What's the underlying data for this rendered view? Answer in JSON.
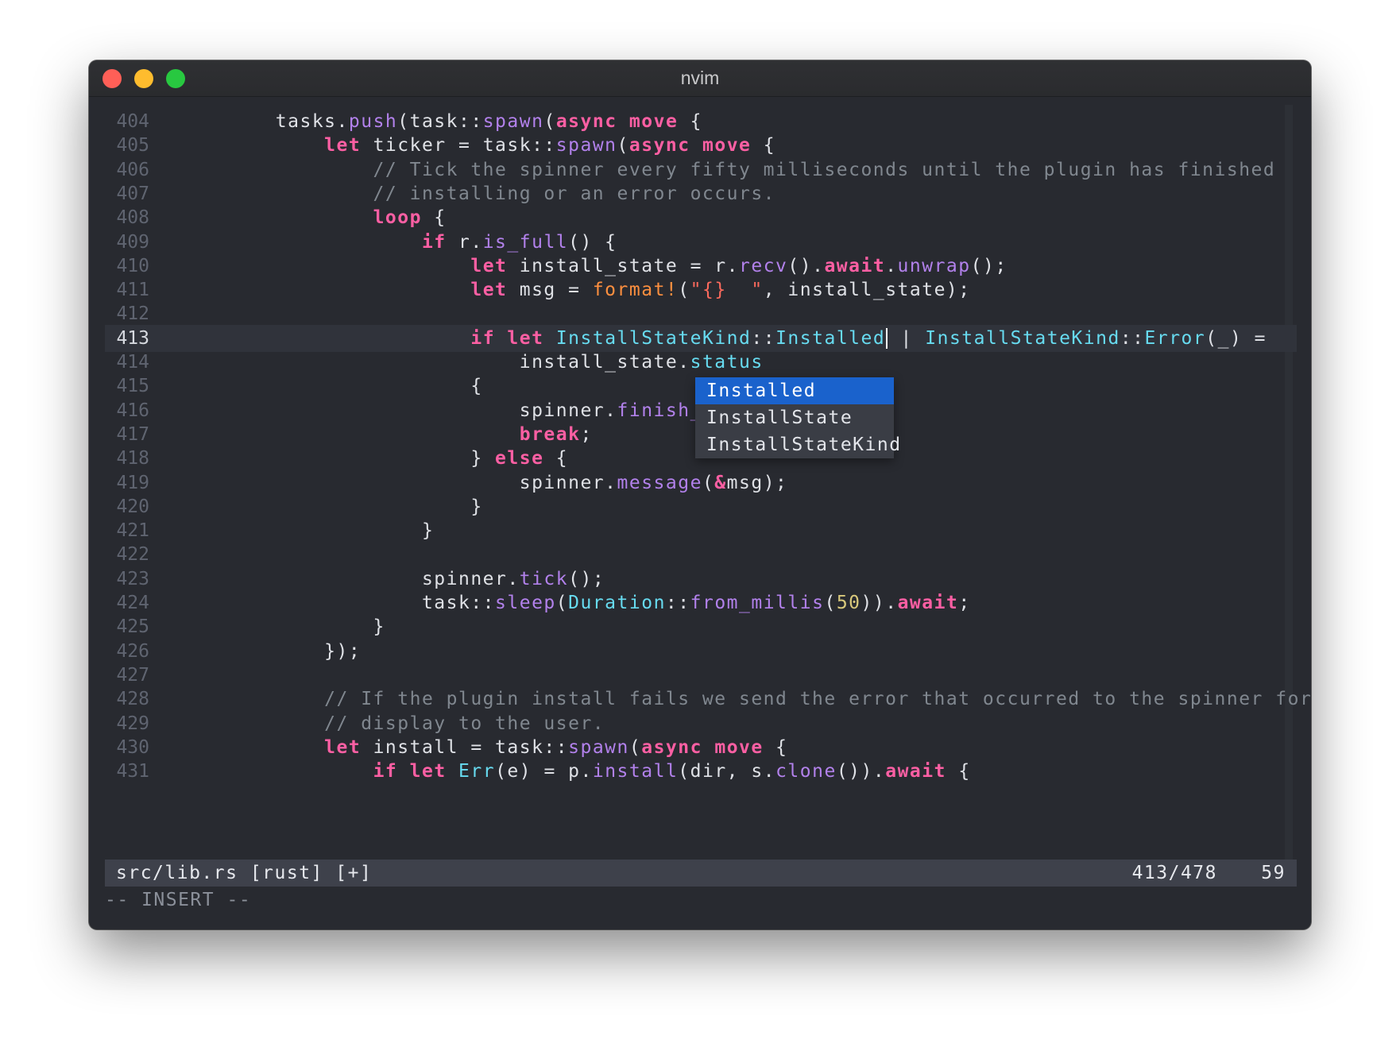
{
  "window": {
    "title": "nvim"
  },
  "editor": {
    "lines": [
      {
        "num": "404",
        "current": false,
        "tokens": [
          {
            "t": "        tasks.",
            "c": "nm"
          },
          {
            "t": "push",
            "c": "fn"
          },
          {
            "t": "(task::",
            "c": "nm"
          },
          {
            "t": "spawn",
            "c": "fn"
          },
          {
            "t": "(",
            "c": "nm"
          },
          {
            "t": "async",
            "c": "kw"
          },
          {
            "t": " ",
            "c": "nm"
          },
          {
            "t": "move",
            "c": "kw"
          },
          {
            "t": " {",
            "c": "nm"
          }
        ]
      },
      {
        "num": "405",
        "current": false,
        "tokens": [
          {
            "t": "            ",
            "c": "nm"
          },
          {
            "t": "let",
            "c": "kw"
          },
          {
            "t": " ticker = task::",
            "c": "nm"
          },
          {
            "t": "spawn",
            "c": "fn"
          },
          {
            "t": "(",
            "c": "nm"
          },
          {
            "t": "async",
            "c": "kw"
          },
          {
            "t": " ",
            "c": "nm"
          },
          {
            "t": "move",
            "c": "kw"
          },
          {
            "t": " {",
            "c": "nm"
          }
        ]
      },
      {
        "num": "406",
        "current": false,
        "tokens": [
          {
            "t": "                // Tick the spinner every fifty milliseconds until the plugin has finished",
            "c": "cm"
          }
        ]
      },
      {
        "num": "407",
        "current": false,
        "tokens": [
          {
            "t": "                // installing or an error occurs.",
            "c": "cm"
          }
        ]
      },
      {
        "num": "408",
        "current": false,
        "tokens": [
          {
            "t": "                ",
            "c": "nm"
          },
          {
            "t": "loop",
            "c": "kw"
          },
          {
            "t": " {",
            "c": "nm"
          }
        ]
      },
      {
        "num": "409",
        "current": false,
        "tokens": [
          {
            "t": "                    ",
            "c": "nm"
          },
          {
            "t": "if",
            "c": "kw"
          },
          {
            "t": " r.",
            "c": "nm"
          },
          {
            "t": "is_full",
            "c": "fn"
          },
          {
            "t": "() {",
            "c": "nm"
          }
        ]
      },
      {
        "num": "410",
        "current": false,
        "tokens": [
          {
            "t": "                        ",
            "c": "nm"
          },
          {
            "t": "let",
            "c": "kw"
          },
          {
            "t": " install_state = r.",
            "c": "nm"
          },
          {
            "t": "recv",
            "c": "fn"
          },
          {
            "t": "().",
            "c": "nm"
          },
          {
            "t": "await",
            "c": "kw"
          },
          {
            "t": ".",
            "c": "nm"
          },
          {
            "t": "unwrap",
            "c": "fn"
          },
          {
            "t": "();",
            "c": "nm"
          }
        ]
      },
      {
        "num": "411",
        "current": false,
        "tokens": [
          {
            "t": "                        ",
            "c": "nm"
          },
          {
            "t": "let",
            "c": "kw"
          },
          {
            "t": " msg = ",
            "c": "nm"
          },
          {
            "t": "format!",
            "c": "mac"
          },
          {
            "t": "(",
            "c": "nm"
          },
          {
            "t": "\"{}  \"",
            "c": "str"
          },
          {
            "t": ", install_state);",
            "c": "nm"
          }
        ]
      },
      {
        "num": "412",
        "current": false,
        "tokens": []
      },
      {
        "num": "413",
        "current": true,
        "tokens": [
          {
            "t": "                        ",
            "c": "nm"
          },
          {
            "t": "if",
            "c": "kw"
          },
          {
            "t": " ",
            "c": "nm"
          },
          {
            "t": "let",
            "c": "kw"
          },
          {
            "t": " ",
            "c": "nm"
          },
          {
            "t": "InstallStateKind",
            "c": "ty"
          },
          {
            "t": "::",
            "c": "nm"
          },
          {
            "t": "Installed",
            "c": "ty"
          },
          {
            "t": "",
            "c": "cursor"
          },
          {
            "t": " | ",
            "c": "nm"
          },
          {
            "t": "InstallStateKind",
            "c": "ty"
          },
          {
            "t": "::",
            "c": "nm"
          },
          {
            "t": "Error",
            "c": "ty"
          },
          {
            "t": "(_) =",
            "c": "nm"
          }
        ]
      },
      {
        "num": "414",
        "current": false,
        "tokens": [
          {
            "t": "                            install_state.",
            "c": "nm"
          },
          {
            "t": "status",
            "c": "ty"
          }
        ]
      },
      {
        "num": "415",
        "current": false,
        "tokens": [
          {
            "t": "                        {",
            "c": "nm"
          }
        ]
      },
      {
        "num": "416",
        "current": false,
        "tokens": [
          {
            "t": "                            spinner.",
            "c": "nm"
          },
          {
            "t": "finish_print",
            "c": "fn"
          }
        ]
      },
      {
        "num": "417",
        "current": false,
        "tokens": [
          {
            "t": "                            ",
            "c": "nm"
          },
          {
            "t": "break",
            "c": "kw"
          },
          {
            "t": ";",
            "c": "nm"
          }
        ]
      },
      {
        "num": "418",
        "current": false,
        "tokens": [
          {
            "t": "                        } ",
            "c": "nm"
          },
          {
            "t": "else",
            "c": "kw"
          },
          {
            "t": " {",
            "c": "nm"
          }
        ]
      },
      {
        "num": "419",
        "current": false,
        "tokens": [
          {
            "t": "                            spinner.",
            "c": "nm"
          },
          {
            "t": "message",
            "c": "fn"
          },
          {
            "t": "(",
            "c": "nm"
          },
          {
            "t": "&",
            "c": "kw"
          },
          {
            "t": "msg);",
            "c": "nm"
          }
        ]
      },
      {
        "num": "420",
        "current": false,
        "tokens": [
          {
            "t": "                        }",
            "c": "nm"
          }
        ]
      },
      {
        "num": "421",
        "current": false,
        "tokens": [
          {
            "t": "                    }",
            "c": "nm"
          }
        ]
      },
      {
        "num": "422",
        "current": false,
        "tokens": []
      },
      {
        "num": "423",
        "current": false,
        "tokens": [
          {
            "t": "                    spinner.",
            "c": "nm"
          },
          {
            "t": "tick",
            "c": "fn"
          },
          {
            "t": "();",
            "c": "nm"
          }
        ]
      },
      {
        "num": "424",
        "current": false,
        "tokens": [
          {
            "t": "                    task::",
            "c": "nm"
          },
          {
            "t": "sleep",
            "c": "fn"
          },
          {
            "t": "(",
            "c": "nm"
          },
          {
            "t": "Duration",
            "c": "ty"
          },
          {
            "t": "::",
            "c": "nm"
          },
          {
            "t": "from_millis",
            "c": "fn"
          },
          {
            "t": "(",
            "c": "nm"
          },
          {
            "t": "50",
            "c": "num"
          },
          {
            "t": ")).",
            "c": "nm"
          },
          {
            "t": "await",
            "c": "kw"
          },
          {
            "t": ";",
            "c": "nm"
          }
        ]
      },
      {
        "num": "425",
        "current": false,
        "tokens": [
          {
            "t": "                }",
            "c": "nm"
          }
        ]
      },
      {
        "num": "426",
        "current": false,
        "tokens": [
          {
            "t": "            });",
            "c": "nm"
          }
        ]
      },
      {
        "num": "427",
        "current": false,
        "tokens": []
      },
      {
        "num": "428",
        "current": false,
        "tokens": [
          {
            "t": "            // If the plugin install fails we send the error that occurred to the spinner for",
            "c": "cm"
          }
        ]
      },
      {
        "num": "429",
        "current": false,
        "tokens": [
          {
            "t": "            // display to the user.",
            "c": "cm"
          }
        ]
      },
      {
        "num": "430",
        "current": false,
        "tokens": [
          {
            "t": "            ",
            "c": "nm"
          },
          {
            "t": "let",
            "c": "kw"
          },
          {
            "t": " install = task::",
            "c": "nm"
          },
          {
            "t": "spawn",
            "c": "fn"
          },
          {
            "t": "(",
            "c": "nm"
          },
          {
            "t": "async",
            "c": "kw"
          },
          {
            "t": " ",
            "c": "nm"
          },
          {
            "t": "move",
            "c": "kw"
          },
          {
            "t": " {",
            "c": "nm"
          }
        ]
      },
      {
        "num": "431",
        "current": false,
        "tokens": [
          {
            "t": "                ",
            "c": "nm"
          },
          {
            "t": "if",
            "c": "kw"
          },
          {
            "t": " ",
            "c": "nm"
          },
          {
            "t": "let",
            "c": "kw"
          },
          {
            "t": " ",
            "c": "nm"
          },
          {
            "t": "Err",
            "c": "ty"
          },
          {
            "t": "(e) = p.",
            "c": "nm"
          },
          {
            "t": "install",
            "c": "fn"
          },
          {
            "t": "(dir, s.",
            "c": "nm"
          },
          {
            "t": "clone",
            "c": "fn"
          },
          {
            "t": "()).",
            "c": "nm"
          },
          {
            "t": "await",
            "c": "kw"
          },
          {
            "t": " {",
            "c": "nm"
          }
        ]
      }
    ]
  },
  "completion": {
    "items": [
      "Installed",
      "InstallState",
      "InstallStateKind"
    ],
    "selected_index": 0
  },
  "statusline": {
    "file": "src/lib.rs [rust] [+]",
    "position": "413/478",
    "column": "59"
  },
  "mode": "-- INSERT --"
}
